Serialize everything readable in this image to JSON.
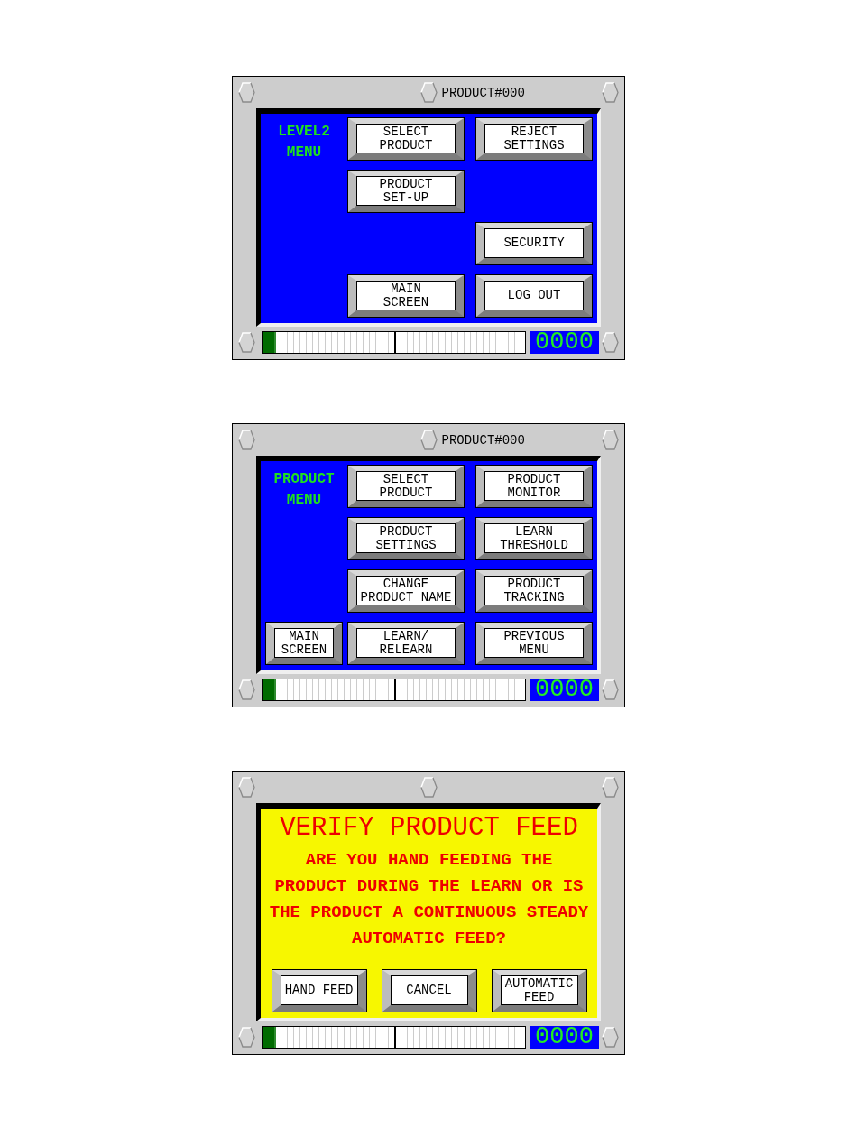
{
  "panels": [
    {
      "header_title": "PRODUCT#000",
      "screen": {
        "kind": "menu",
        "menu_title": "LEVEL2\nMENU",
        "button_rows": [
          [
            null,
            "SELECT\nPRODUCT",
            "REJECT\nSETTINGS"
          ],
          [
            null,
            "PRODUCT\nSET-UP",
            null
          ],
          [
            null,
            null,
            "SECURITY"
          ],
          [
            null,
            "MAIN\nSCREEN",
            "LOG OUT"
          ]
        ]
      },
      "meter": {
        "level": 0.05
      },
      "counter": "0000"
    },
    {
      "header_title": "PRODUCT#000",
      "screen": {
        "kind": "menu",
        "menu_title": "PRODUCT\nMENU",
        "button_rows": [
          [
            null,
            "SELECT\nPRODUCT",
            "PRODUCT\nMONITOR"
          ],
          [
            null,
            "PRODUCT\nSETTINGS",
            "LEARN\nTHRESHOLD"
          ],
          [
            null,
            "CHANGE\nPRODUCT NAME",
            "PRODUCT\nTRACKING"
          ],
          [
            "MAIN\nSCREEN",
            "LEARN/\nRELEARN",
            "PREVIOUS\nMENU"
          ]
        ]
      },
      "meter": {
        "level": 0.05
      },
      "counter": "0000"
    },
    {
      "screen": {
        "kind": "dialog",
        "title": "VERIFY PRODUCT FEED",
        "message": "ARE YOU HAND FEEDING THE\nPRODUCT DURING THE LEARN OR IS\nTHE PRODUCT A CONTINUOUS STEADY\nAUTOMATIC FEED?",
        "buttons": [
          "HAND FEED",
          "CANCEL",
          "AUTOMATIC\nFEED"
        ]
      },
      "meter": {
        "level": 0.05
      },
      "counter": "0000"
    }
  ]
}
